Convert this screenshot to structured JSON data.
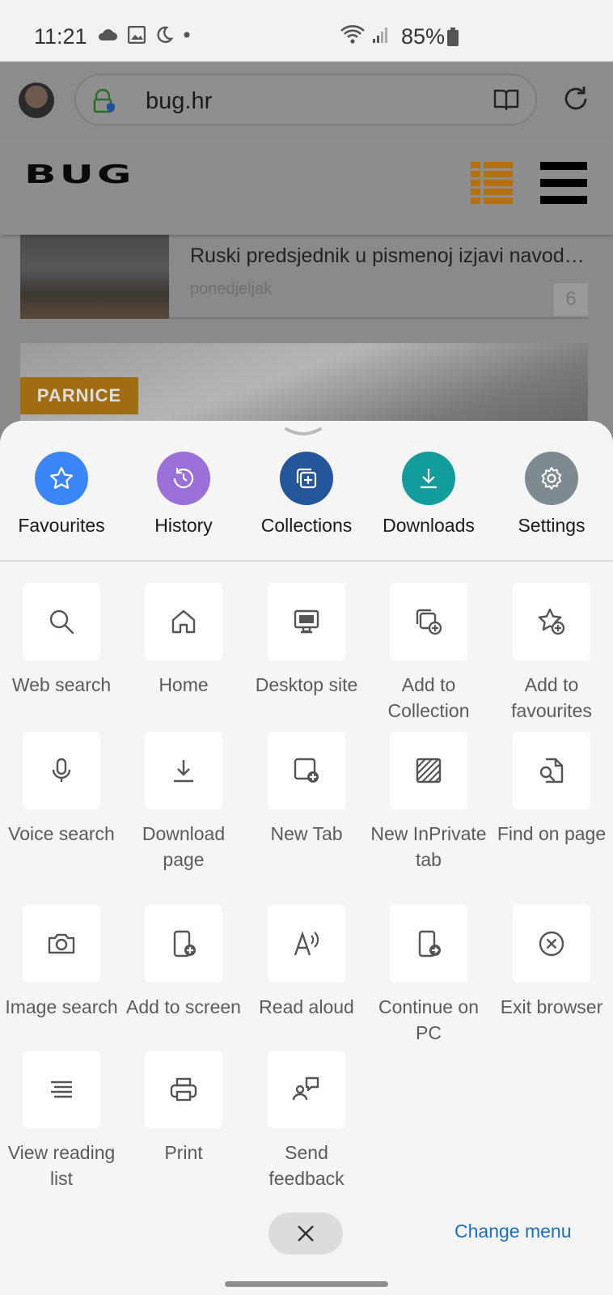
{
  "status_bar": {
    "time": "11:21",
    "battery": "85%"
  },
  "browser_toolbar": {
    "url": "bug.hr",
    "icons": [
      "avatar",
      "lock-shield-icon",
      "reader-mode-icon",
      "refresh-icon"
    ]
  },
  "page": {
    "logo": "BUG",
    "article_snippet": "Ruski predsjednik u pismenoj izjavi navod…",
    "article_date": "ponedjeljak",
    "comment_count": "6",
    "hero_tag": "PARNICE"
  },
  "quick_actions": [
    {
      "label": "Favourites",
      "icon": "star-icon",
      "color": "#3a86f7"
    },
    {
      "label": "History",
      "icon": "history-icon",
      "color": "#9a6fd8"
    },
    {
      "label": "Collections",
      "icon": "collections-icon",
      "color": "#24569c"
    },
    {
      "label": "Downloads",
      "icon": "download-icon",
      "color": "#139c9c"
    },
    {
      "label": "Settings",
      "icon": "gear-icon",
      "color": "#7d8a90"
    }
  ],
  "menu_items": [
    {
      "label": "Web search",
      "icon": "search-icon"
    },
    {
      "label": "Home",
      "icon": "home-icon"
    },
    {
      "label": "Desktop site",
      "icon": "desktop-icon"
    },
    {
      "label": "Add to Collection",
      "icon": "add-collection-icon"
    },
    {
      "label": "Add to favourites",
      "icon": "add-favourite-icon"
    },
    {
      "label": "Voice search",
      "icon": "microphone-icon"
    },
    {
      "label": "Download page",
      "icon": "download-page-icon"
    },
    {
      "label": "New Tab",
      "icon": "new-tab-icon"
    },
    {
      "label": "New InPrivate tab",
      "icon": "inprivate-icon"
    },
    {
      "label": "Find on page",
      "icon": "find-on-page-icon"
    },
    {
      "label": "Image search",
      "icon": "camera-icon"
    },
    {
      "label": "Add to screen",
      "icon": "add-to-screen-icon"
    },
    {
      "label": "Read aloud",
      "icon": "read-aloud-icon"
    },
    {
      "label": "Continue on PC",
      "icon": "continue-on-pc-icon"
    },
    {
      "label": "Exit browser",
      "icon": "exit-icon"
    },
    {
      "label": "View reading list",
      "icon": "reading-list-icon"
    },
    {
      "label": "Print",
      "icon": "printer-icon"
    },
    {
      "label": "Send feedback",
      "icon": "feedback-icon"
    }
  ],
  "footer": {
    "change_menu": "Change menu"
  }
}
